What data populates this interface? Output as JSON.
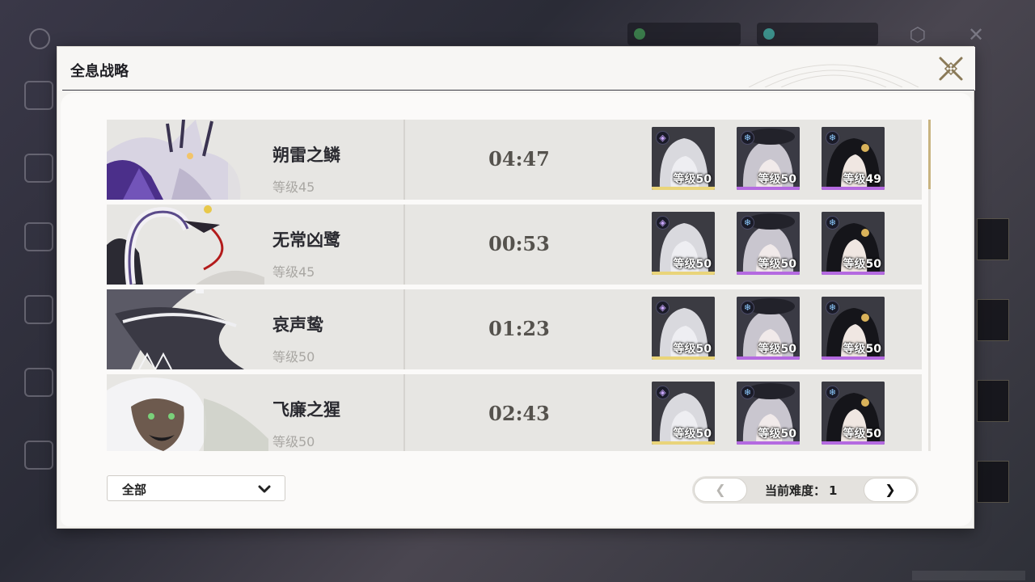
{
  "background": {
    "title": "",
    "currency_1": "",
    "currency_2": ""
  },
  "dialog": {
    "title": "全息战略"
  },
  "rows": [
    {
      "boss_name": "朔雷之鳞",
      "boss_level": "等级45",
      "time": "04:47",
      "team": [
        {
          "element": "havoc-icon",
          "level": "等级50",
          "rarity": "gold"
        },
        {
          "element": "glacio-icon",
          "level": "等级50",
          "rarity": "purple"
        },
        {
          "element": "glacio-icon",
          "level": "等级49",
          "rarity": "purple"
        }
      ]
    },
    {
      "boss_name": "无常凶鹭",
      "boss_level": "等级45",
      "time": "00:53",
      "team": [
        {
          "element": "havoc-icon",
          "level": "等级50",
          "rarity": "gold"
        },
        {
          "element": "glacio-icon",
          "level": "等级50",
          "rarity": "purple"
        },
        {
          "element": "glacio-icon",
          "level": "等级50",
          "rarity": "purple"
        }
      ]
    },
    {
      "boss_name": "哀声鸷",
      "boss_level": "等级50",
      "time": "01:23",
      "team": [
        {
          "element": "havoc-icon",
          "level": "等级50",
          "rarity": "gold"
        },
        {
          "element": "glacio-icon",
          "level": "等级50",
          "rarity": "purple"
        },
        {
          "element": "glacio-icon",
          "level": "等级50",
          "rarity": "purple"
        }
      ]
    },
    {
      "boss_name": "飞廉之猩",
      "boss_level": "等级50",
      "time": "02:43",
      "team": [
        {
          "element": "havoc-icon",
          "level": "等级50",
          "rarity": "gold"
        },
        {
          "element": "glacio-icon",
          "level": "等级50",
          "rarity": "purple"
        },
        {
          "element": "glacio-icon",
          "level": "等级50",
          "rarity": "purple"
        }
      ]
    }
  ],
  "filter": {
    "selected": "全部"
  },
  "pager": {
    "label": "当前难度：",
    "value": "1",
    "prev": "❮",
    "next": "❯"
  },
  "colors": {
    "rarity_gold": "#e9d47a",
    "rarity_purple": "#b46ae0",
    "accent": "#c9b481"
  }
}
